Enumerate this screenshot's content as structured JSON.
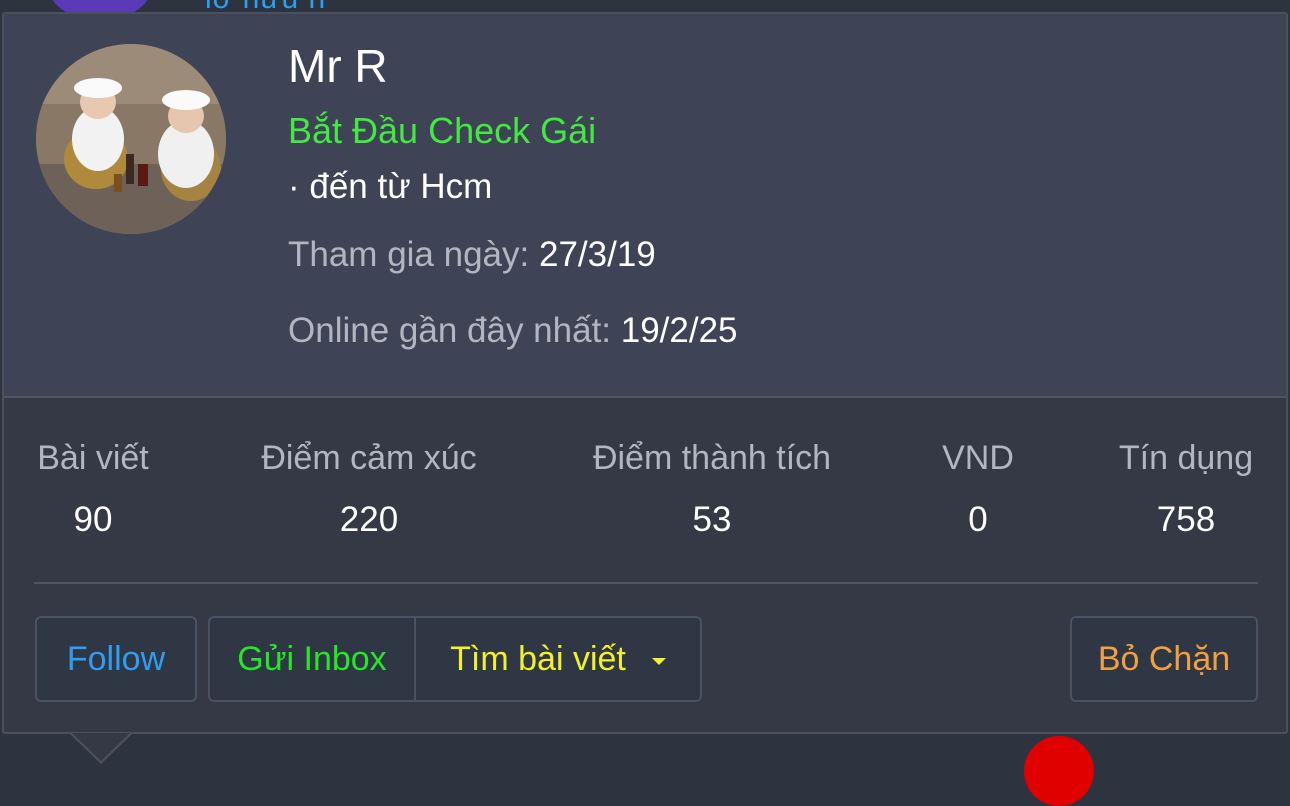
{
  "background": {
    "link_text": "lớ hữu h"
  },
  "profile": {
    "name": "Mr R",
    "title": "Bắt Đầu Check Gái",
    "location": "· đến từ Hcm",
    "joined_label": "Tham gia ngày:",
    "joined_value": "27/3/19",
    "last_seen_label": "Online gần đây nhất:",
    "last_seen_value": "19/2/25"
  },
  "stats": [
    {
      "label": "Bài viết",
      "value": "90"
    },
    {
      "label": "Điểm cảm xúc",
      "value": "220"
    },
    {
      "label": "Điểm thành tích",
      "value": "53"
    },
    {
      "label": "VND",
      "value": "0"
    },
    {
      "label": "Tín dụng",
      "value": "758"
    }
  ],
  "actions": {
    "follow": "Follow",
    "inbox": "Gửi Inbox",
    "find_posts": "Tìm bài viết",
    "unblock": "Bỏ Chặn"
  },
  "colors": {
    "title_green": "#41e941",
    "follow_blue": "#2f9df0",
    "inbox_green": "#25e825",
    "find_yellow": "#f2f22a",
    "unblock_orange": "#f0a040",
    "card_header": "#3e4455",
    "card_body": "#343945"
  },
  "icons": {
    "find_dropdown": "caret-down-icon"
  }
}
